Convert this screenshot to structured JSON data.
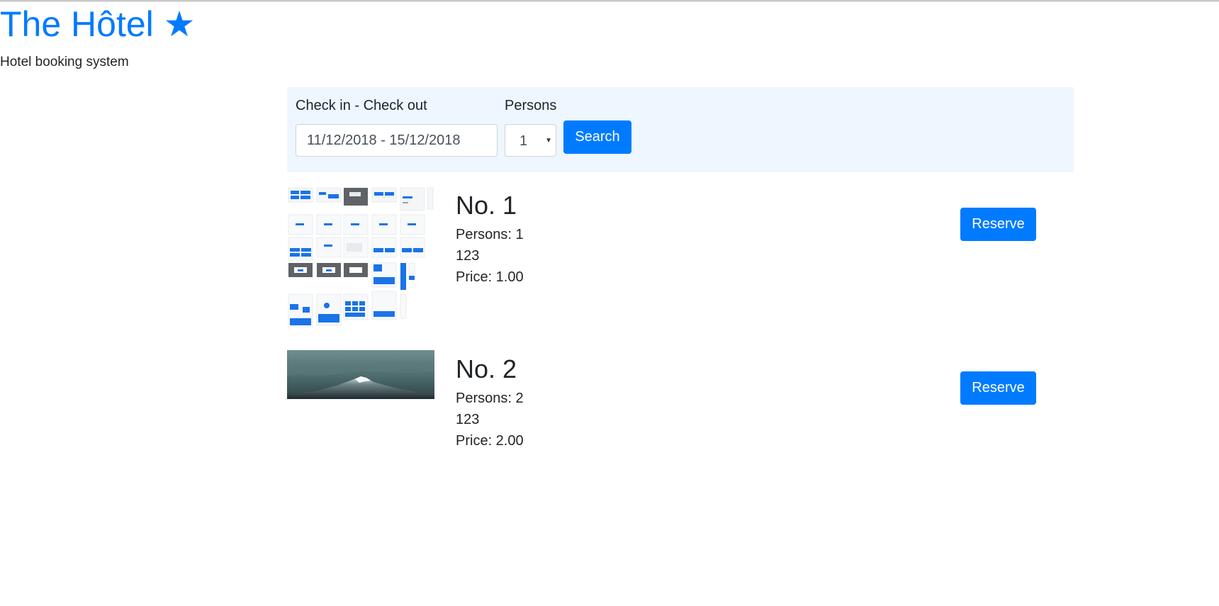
{
  "app": {
    "title": "The Hôtel ★",
    "tagline": "Hotel booking system"
  },
  "search": {
    "dates_label": "Check in - Check out",
    "dates_value": "11/12/2018 - 15/12/2018",
    "persons_label": "Persons",
    "persons_value": "1",
    "search_label": "Search"
  },
  "rooms": [
    {
      "title": "No. 1",
      "persons": "Persons: 1",
      "description": "123",
      "price": "Price: 1.00",
      "reserve_label": "Reserve",
      "image": "ui-screens-collage-thumbnail"
    },
    {
      "title": "No. 2",
      "persons": "Persons: 2",
      "description": "123",
      "price": "Price: 2.00",
      "reserve_label": "Reserve",
      "image": "mountain-night-sky-thumbnail"
    }
  ],
  "colors": {
    "brand": "#007bff",
    "panel_background": "#eef6ff",
    "text": "#212529"
  }
}
